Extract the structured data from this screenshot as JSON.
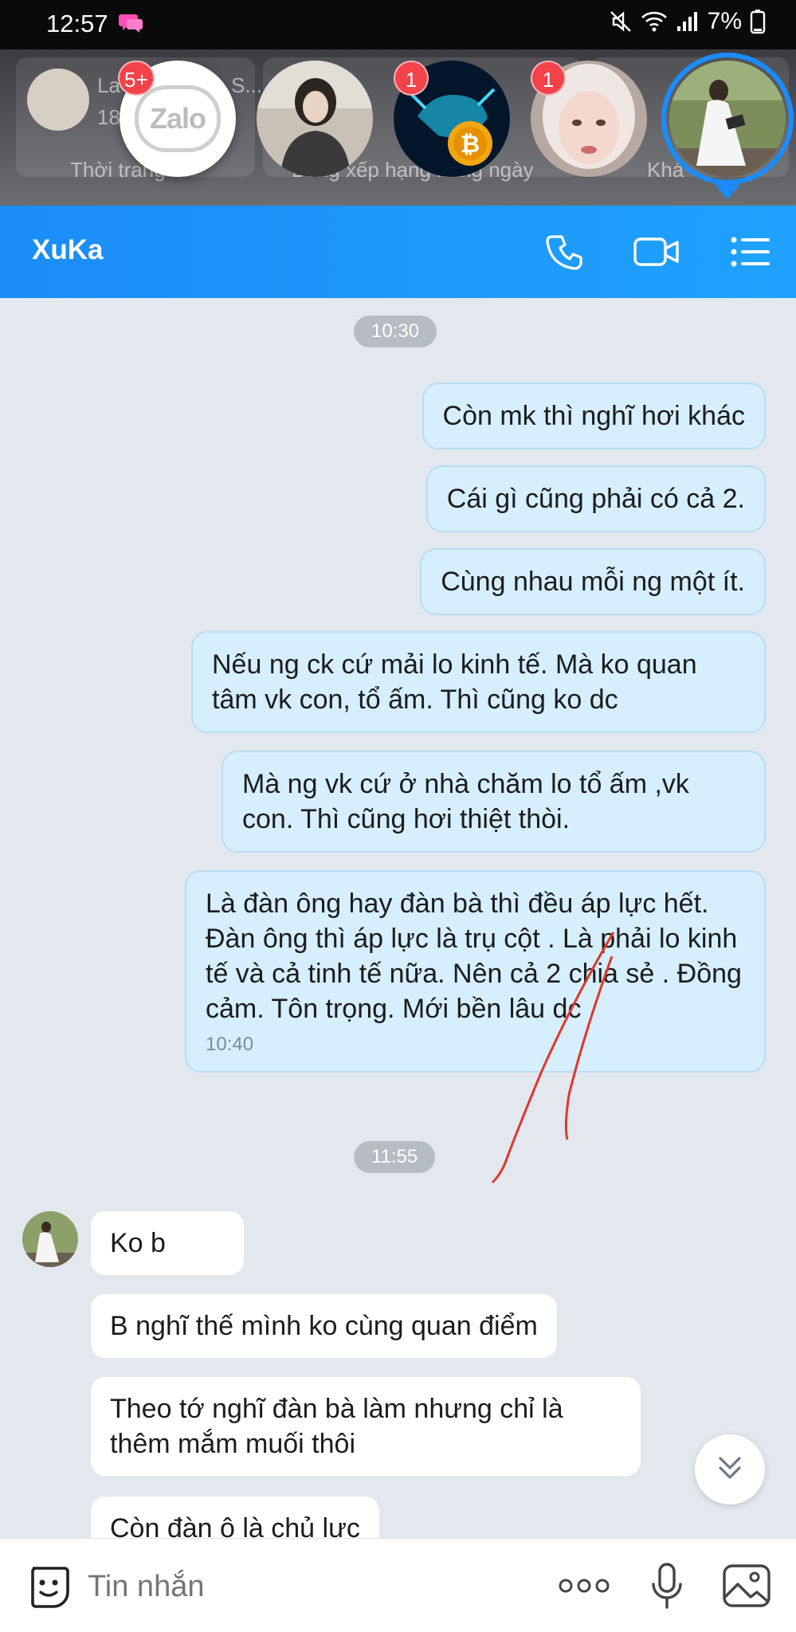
{
  "status_bar": {
    "time": "12:57",
    "battery": "7%",
    "icons": [
      "messenger-chat-icon",
      "mute-icon",
      "wifi-icon",
      "signal-icon",
      "battery-icon"
    ]
  },
  "chat_heads": {
    "background_texts": [
      "La",
      "S...",
      "18",
      "Thời trang ...",
      "Bảng xếp hạng hàng ngày",
      "Khá"
    ],
    "zalo_label": "Zalo",
    "badges": [
      "5+",
      "1",
      "1"
    ]
  },
  "header": {
    "title": "XuKa",
    "icons": [
      "phone-icon",
      "video-call-icon",
      "menu-list-icon"
    ]
  },
  "messages": {
    "time_1": "10:30",
    "out_1": "Còn mk thì nghĩ hơi khác",
    "out_2": "Cái gì cũng  phải có cả 2.",
    "out_3": "Cùng nhau mỗi ng một ít.",
    "out_4": "Nếu ng ck cứ mải lo kinh tế. Mà ko quan tâm vk con, tổ ấm. Thì cũng ko dc",
    "out_5": "Mà ng vk cứ ở nhà chăm lo tổ ấm ,vk con. Thì cũng hơi thiệt thòi.",
    "out_6": "Là đàn ông hay đàn bà thì đều áp lực hết. Đàn ông thì áp lực là trụ cột . Là phải lo kinh tế và cả tinh tế nữa. Nên cả 2 chia sẻ . Đồng  cảm.  Tôn trọng. Mới bền lâu dc",
    "out_6_time": "10:40",
    "time_2": "11:55",
    "in_1": "Ko b",
    "in_2": "B nghĩ thế mình ko cùng quan điểm",
    "in_3": "Theo tớ nghĩ đàn bà làm nhưng chỉ là thêm mắm muối thôi",
    "in_4": "Còn đàn ô là chủ lực"
  },
  "input_bar": {
    "placeholder": "Tin nhắn",
    "icons": [
      "sticker-icon",
      "more-options-icon",
      "microphone-icon",
      "image-icon"
    ]
  },
  "colors": {
    "header_blue": "#1b8cf8",
    "outgoing_bubble": "#d5efff",
    "incoming_bubble": "#ffffff",
    "chat_background": "#e2e8ee",
    "badge_red": "#f2424a",
    "annotation_red": "#e0362c"
  }
}
